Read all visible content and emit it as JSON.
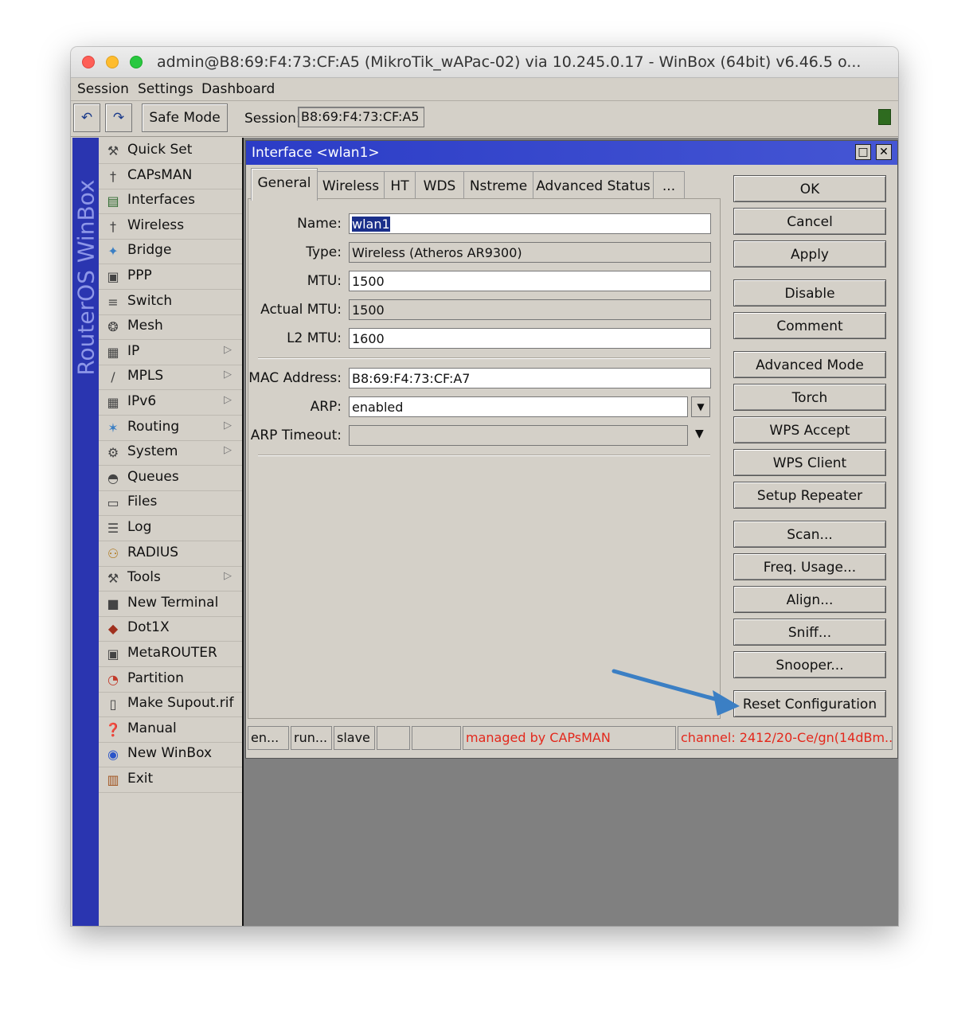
{
  "window": {
    "title": "admin@B8:69:F4:73:CF:A5 (MikroTik_wAPac-02) via 10.245.0.17 - WinBox (64bit) v6.46.5 o..."
  },
  "menubar": [
    "Session",
    "Settings",
    "Dashboard"
  ],
  "toolbar": {
    "safe_mode": "Safe Mode",
    "session_label": "Session:",
    "session_value": "B8:69:F4:73:CF:A5"
  },
  "sidebar": {
    "brand": "RouterOS WinBox",
    "items": [
      {
        "label": "Quick Set",
        "icon": "quickset-icon"
      },
      {
        "label": "CAPsMAN",
        "icon": "capsman-icon"
      },
      {
        "label": "Interfaces",
        "icon": "interfaces-icon"
      },
      {
        "label": "Wireless",
        "icon": "wireless-icon"
      },
      {
        "label": "Bridge",
        "icon": "bridge-icon"
      },
      {
        "label": "PPP",
        "icon": "ppp-icon"
      },
      {
        "label": "Switch",
        "icon": "switch-icon"
      },
      {
        "label": "Mesh",
        "icon": "mesh-icon"
      },
      {
        "label": "IP",
        "icon": "ip-icon",
        "submenu": true
      },
      {
        "label": "MPLS",
        "icon": "mpls-icon",
        "submenu": true
      },
      {
        "label": "IPv6",
        "icon": "ipv6-icon",
        "submenu": true
      },
      {
        "label": "Routing",
        "icon": "routing-icon",
        "submenu": true
      },
      {
        "label": "System",
        "icon": "system-icon",
        "submenu": true
      },
      {
        "label": "Queues",
        "icon": "queues-icon"
      },
      {
        "label": "Files",
        "icon": "files-icon"
      },
      {
        "label": "Log",
        "icon": "log-icon"
      },
      {
        "label": "RADIUS",
        "icon": "radius-icon"
      },
      {
        "label": "Tools",
        "icon": "tools-icon",
        "submenu": true
      },
      {
        "label": "New Terminal",
        "icon": "terminal-icon"
      },
      {
        "label": "Dot1X",
        "icon": "dot1x-icon"
      },
      {
        "label": "MetaROUTER",
        "icon": "metarouter-icon"
      },
      {
        "label": "Partition",
        "icon": "partition-icon"
      },
      {
        "label": "Make Supout.rif",
        "icon": "supout-icon"
      },
      {
        "label": "Manual",
        "icon": "manual-icon"
      },
      {
        "label": "New WinBox",
        "icon": "new-winbox-icon"
      },
      {
        "label": "Exit",
        "icon": "exit-icon"
      }
    ]
  },
  "dialog": {
    "title": "Interface <wlan1>",
    "tabs": [
      "General",
      "Wireless",
      "HT",
      "WDS",
      "Nstreme",
      "Advanced Status",
      "..."
    ],
    "fields": {
      "name_label": "Name:",
      "name": "wlan1",
      "type_label": "Type:",
      "type": "Wireless (Atheros AR9300)",
      "mtu_label": "MTU:",
      "mtu": "1500",
      "actual_mtu_label": "Actual MTU:",
      "actual_mtu": "1500",
      "l2mtu_label": "L2 MTU:",
      "l2mtu": "1600",
      "mac_label": "MAC Address:",
      "mac": "B8:69:F4:73:CF:A7",
      "arp_label": "ARP:",
      "arp": "enabled",
      "arp_timeout_label": "ARP Timeout:",
      "arp_timeout": ""
    },
    "actions": [
      "OK",
      "Cancel",
      "Apply",
      "Disable",
      "Comment",
      "Advanced Mode",
      "Torch",
      "WPS Accept",
      "WPS Client",
      "Setup Repeater",
      "Scan...",
      "Freq. Usage...",
      "Align...",
      "Sniff...",
      "Snooper...",
      "Reset Configuration"
    ],
    "status": [
      "en...",
      "run...",
      "slave",
      "",
      "",
      "managed by CAPsMAN",
      "channel: 2412/20-Ce/gn(14dBm..."
    ]
  },
  "colors": {
    "accent_blue": "#2b3cc6",
    "status_red": "#e3281c",
    "annotation_arrow": "#3b7fc4"
  }
}
